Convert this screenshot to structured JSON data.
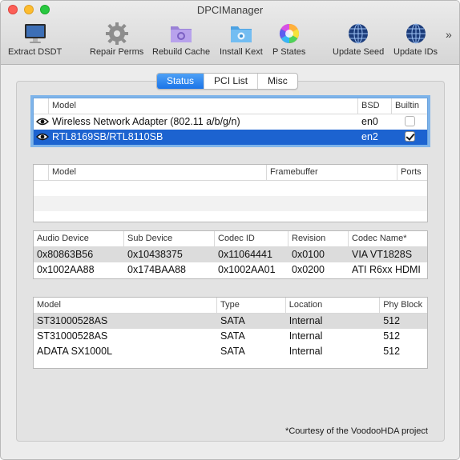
{
  "window": {
    "title": "DPCIManager"
  },
  "toolbar": {
    "items": [
      {
        "label": "Extract DSDT",
        "icon": "monitor-icon"
      },
      {
        "label": "Repair Perms",
        "icon": "gear-icon"
      },
      {
        "label": "Rebuild Cache",
        "icon": "purple-folder-icon"
      },
      {
        "label": "Install Kext",
        "icon": "blue-folder-icon"
      },
      {
        "label": "P States",
        "icon": "color-wheel-icon"
      },
      {
        "label": "Update Seed",
        "icon": "globe-icon"
      },
      {
        "label": "Update IDs",
        "icon": "globe-icon"
      }
    ],
    "overflow": "»"
  },
  "tabs": [
    {
      "label": "Status",
      "active": true
    },
    {
      "label": "PCI List",
      "active": false
    },
    {
      "label": "Misc",
      "active": false
    }
  ],
  "network": {
    "headers": [
      "",
      "Model",
      "BSD",
      "Builtin"
    ],
    "rows": [
      {
        "model": "Wireless Network Adapter (802.11 a/b/g/n)",
        "bsd": "en0",
        "builtin": false,
        "selected": false
      },
      {
        "model": "RTL8169SB/RTL8110SB",
        "bsd": "en2",
        "builtin": true,
        "selected": true
      }
    ]
  },
  "graphics": {
    "headers": [
      "Model",
      "Framebuffer",
      "Ports"
    ]
  },
  "audio": {
    "headers": [
      "Audio Device",
      "Sub Device",
      "Codec ID",
      "Revision",
      "Codec Name*"
    ],
    "rows": [
      [
        "0x80863B56",
        "0x10438375",
        "0x11064441",
        "0x0100",
        "VIA VT1828S"
      ],
      [
        "0x1002AA88",
        "0x174BAA88",
        "0x1002AA01",
        "0x0200",
        "ATI R6xx HDMI"
      ]
    ]
  },
  "storage": {
    "headers": [
      "Model",
      "Type",
      "Location",
      "Phy Block"
    ],
    "rows": [
      [
        "ST31000528AS",
        "SATA",
        "Internal",
        "512"
      ],
      [
        "ST31000528AS",
        "SATA",
        "Internal",
        "512"
      ],
      [
        "ADATA SX1000L",
        "SATA",
        "Internal",
        "512"
      ]
    ]
  },
  "footnote": "*Courtesy of the VoodooHDA project"
}
